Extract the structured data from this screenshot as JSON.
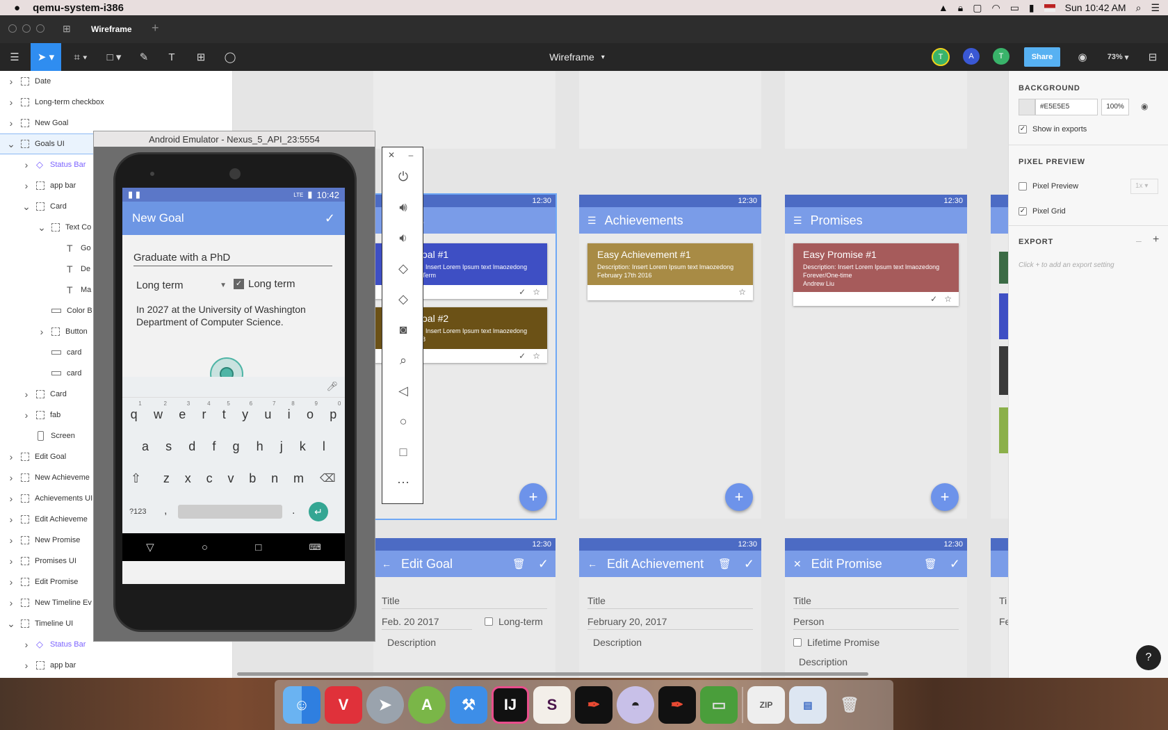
{
  "menubar": {
    "app_name": "qemu-system-i386",
    "clock": "Sun 10:42 AM"
  },
  "tabs": {
    "active": "Wireframe",
    "add": "+"
  },
  "toolbar": {
    "doc_title": "Wireframe",
    "share_label": "Share",
    "zoom": "73%",
    "avatars": [
      "T",
      "A",
      "T"
    ]
  },
  "layers": [
    {
      "label": "Date",
      "indent": 0,
      "caret": "right",
      "type": "group"
    },
    {
      "label": "Long-term checkbox",
      "indent": 0,
      "caret": "right",
      "type": "group"
    },
    {
      "label": "New Goal",
      "indent": 0,
      "caret": "right",
      "type": "group"
    },
    {
      "label": "Goals UI",
      "indent": 0,
      "caret": "down",
      "type": "group",
      "selected": true
    },
    {
      "label": "Status Bar",
      "indent": 1,
      "caret": "right",
      "type": "symbol"
    },
    {
      "label": "app bar",
      "indent": 1,
      "caret": "right",
      "type": "group"
    },
    {
      "label": "Card",
      "indent": 1,
      "caret": "down",
      "type": "group"
    },
    {
      "label": "Text Co",
      "indent": 2,
      "caret": "down",
      "type": "group"
    },
    {
      "label": "Go",
      "indent": 3,
      "caret": "",
      "type": "text"
    },
    {
      "label": "De",
      "indent": 3,
      "caret": "",
      "type": "text"
    },
    {
      "label": "Ma",
      "indent": 3,
      "caret": "",
      "type": "text"
    },
    {
      "label": "Color B",
      "indent": 2,
      "caret": "",
      "type": "rect"
    },
    {
      "label": "Button",
      "indent": 2,
      "caret": "right",
      "type": "group"
    },
    {
      "label": "card",
      "indent": 2,
      "caret": "",
      "type": "rect"
    },
    {
      "label": "card",
      "indent": 2,
      "caret": "",
      "type": "rect"
    },
    {
      "label": "Card",
      "indent": 1,
      "caret": "right",
      "type": "group"
    },
    {
      "label": "fab",
      "indent": 1,
      "caret": "right",
      "type": "group"
    },
    {
      "label": "Screen",
      "indent": 1,
      "caret": "",
      "type": "screen"
    },
    {
      "label": "Edit Goal",
      "indent": 0,
      "caret": "right",
      "type": "group"
    },
    {
      "label": "New Achieveme",
      "indent": 0,
      "caret": "right",
      "type": "group"
    },
    {
      "label": "Achievements UI",
      "indent": 0,
      "caret": "right",
      "type": "group"
    },
    {
      "label": "Edit Achieveme",
      "indent": 0,
      "caret": "right",
      "type": "group"
    },
    {
      "label": "New Promise",
      "indent": 0,
      "caret": "right",
      "type": "group"
    },
    {
      "label": "Promises UI",
      "indent": 0,
      "caret": "right",
      "type": "group"
    },
    {
      "label": "Edit Promise",
      "indent": 0,
      "caret": "right",
      "type": "group"
    },
    {
      "label": "New Timeline Ev",
      "indent": 0,
      "caret": "right",
      "type": "group"
    },
    {
      "label": "Timeline UI",
      "indent": 0,
      "caret": "down",
      "type": "group"
    },
    {
      "label": "Status Bar",
      "indent": 1,
      "caret": "right",
      "type": "symbol"
    },
    {
      "label": "app bar",
      "indent": 1,
      "caret": "right",
      "type": "group"
    }
  ],
  "inspector": {
    "background_heading": "BACKGROUND",
    "bg_hex": "#E5E5E5",
    "bg_opacity": "100%",
    "show_in_exports": "Show in exports",
    "pixel_preview_heading": "PIXEL PREVIEW",
    "pixel_preview": "Pixel Preview",
    "pixel_scale": "1x",
    "pixel_grid": "Pixel Grid",
    "export_heading": "EXPORT",
    "export_hint": "Click + to add an export setting"
  },
  "artboards": {
    "time": "12:30",
    "goals": {
      "title": "ls",
      "card1_title": "oal #1",
      "card1_desc": ": Insert Lorem Ipsum text lmaozedong",
      "card1_desc2": "Term",
      "card2_title": "oal #2",
      "card2_desc": ": Insert Lorem Ipsum text lmaozedong",
      "card2_desc2": "8"
    },
    "achievements": {
      "title": "Achievements",
      "card_title": "Easy Achievement #1",
      "card_desc": "Description: Insert Lorem Ipsum text lmaozedong",
      "card_date": "February 17th 2016"
    },
    "promises": {
      "title": "Promises",
      "card_title": "Easy Promise #1",
      "card_desc": "Description: Insert Lorem Ipsum text lmaozedong",
      "card_type": "Forever/One-time",
      "card_person": "Andrew Liu"
    },
    "edit_goal": {
      "title": "Edit Goal",
      "field_title": "Title",
      "date": "Feb. 20 2017",
      "long_term": "Long-term",
      "description": "Description"
    },
    "edit_achievement": {
      "title": "Edit Achievement",
      "field_title": "Title",
      "date": "February 20, 2017",
      "description": "Description"
    },
    "edit_promise": {
      "title": "Edit Promise",
      "field_title": "Title",
      "person": "Person",
      "lifetime": "Lifetime Promise",
      "description": "Description"
    },
    "partial": {
      "title": "Ti",
      "date": "Fe"
    }
  },
  "emulator": {
    "window_title": "Android Emulator - Nexus_5_API_23:5554",
    "clock": "10:42",
    "status_lte": "LTE",
    "app_title": "New Goal",
    "goal_text": "Graduate with a PhD",
    "dropdown_value": "Long term",
    "checkbox_label": "Long term",
    "description": "In 2027 at the University of Washington Department of Computer Science.",
    "keyboard": {
      "row1": [
        "q",
        "w",
        "e",
        "r",
        "t",
        "y",
        "u",
        "i",
        "o",
        "p"
      ],
      "row1_hints": [
        "1",
        "2",
        "3",
        "4",
        "5",
        "6",
        "7",
        "8",
        "9",
        "0"
      ],
      "row2": [
        "a",
        "s",
        "d",
        "f",
        "g",
        "h",
        "j",
        "k",
        "l"
      ],
      "row3": [
        "z",
        "x",
        "c",
        "v",
        "b",
        "n",
        "m"
      ],
      "symbols": "?123",
      "comma": ",",
      "period": "."
    }
  },
  "dock": {
    "apps": [
      "finder",
      "vivaldi",
      "launchpad",
      "android-studio",
      "xcode",
      "intellij",
      "slack",
      "sketch",
      "github",
      "sketch-2",
      "sublime",
      "zip",
      "screenshot",
      "trash"
    ]
  },
  "help_label": "?"
}
